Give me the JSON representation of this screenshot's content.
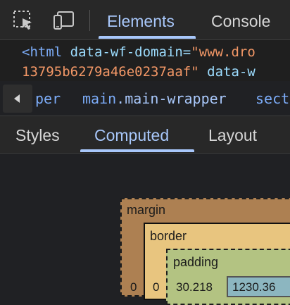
{
  "toolbar": {
    "icons": [
      "inspect-element-icon",
      "device-toolbar-icon"
    ],
    "tabs": [
      {
        "label": "Elements",
        "active": true
      },
      {
        "label": "Console",
        "active": false
      }
    ]
  },
  "code": {
    "line1": {
      "tag": "<html",
      "attr": "data-wf-domain=",
      "value": "\"www.dro"
    },
    "line2": {
      "value": "13795b6279a46e0237aaf\"",
      "attr": "data-w"
    }
  },
  "breadcrumbs": {
    "items": [
      {
        "text": "per"
      },
      {
        "tag": "main",
        "cls": ".main-wrapper"
      },
      {
        "tag": "sect"
      }
    ]
  },
  "subtabs": [
    {
      "label": "Styles",
      "active": false
    },
    {
      "label": "Computed",
      "active": true
    },
    {
      "label": "Layout",
      "active": false
    }
  ],
  "box_model": {
    "margin_label": "margin",
    "border_label": "border",
    "padding_label": "padding",
    "margin_left": "0",
    "border_left": "0",
    "padding_left": "30.218",
    "content_width": "1230.36"
  },
  "colors": {
    "accent": "#a8c7fa",
    "margin": "#ad8052",
    "border": "#e8c57f",
    "padding": "#b3c382",
    "content": "#8cb6c0"
  }
}
